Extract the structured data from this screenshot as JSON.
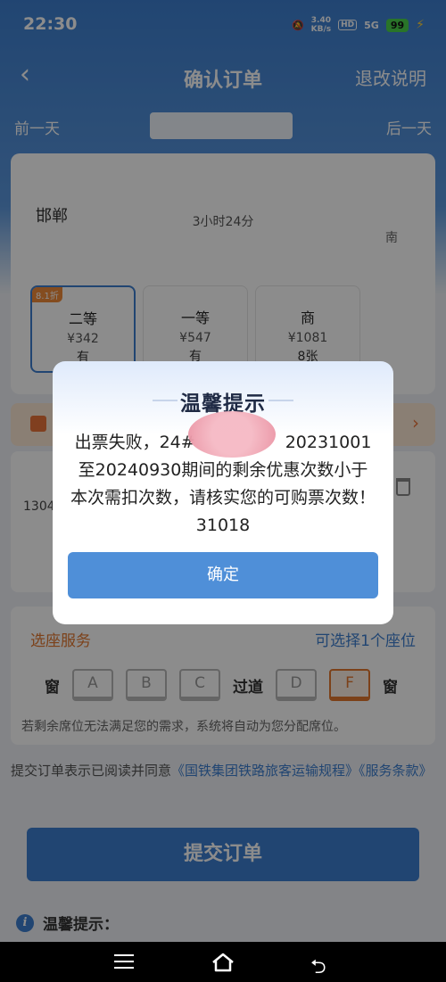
{
  "status_bar": {
    "time": "22:30",
    "net_speed_top": "3.40",
    "net_speed_bottom": "KB/s",
    "hd_badge": "HD",
    "signal": "5G",
    "battery": "99"
  },
  "nav": {
    "title": "确认订单",
    "right_link": "退改说明"
  },
  "date_bar": {
    "prev": "前一天",
    "next": "后一天"
  },
  "train": {
    "dep_station": "邯郸",
    "duration": "3小时24分",
    "arr_station": "南"
  },
  "seats": [
    {
      "badge": "8.1折",
      "name": "二等",
      "price": "¥342",
      "avail": "有"
    },
    {
      "badge": "",
      "name": "一等",
      "price": "¥547",
      "avail": "有"
    },
    {
      "badge": "",
      "name": "商",
      "price": "¥1081",
      "avail": "8张"
    }
  ],
  "passenger": {
    "id_prefix": "1304"
  },
  "dialog": {
    "title": "温馨提示",
    "message": "出票失败，24#　　　　　 20231001至20240930期间的剩余优惠次数小于本次需扣次数，请核实您的可购票次数！31018",
    "confirm_label": "确定"
  },
  "seat_service": {
    "title": "选座服务",
    "hint": "可选择1个座位",
    "window_label": "窗",
    "aisle_label": "过道",
    "seat_letters": [
      "A",
      "B",
      "C",
      "D",
      "F"
    ],
    "selected_seat": "F",
    "note": "若剩余席位无法满足您的需求，系统将自动为您分配席位。"
  },
  "agreement": {
    "prefix": "提交订单表示已阅读并同意",
    "link1": "《国铁集团铁路旅客运输规程》",
    "link2": "《服务条款》"
  },
  "submit_label": "提交订单",
  "tips_label": "温馨提示："
}
